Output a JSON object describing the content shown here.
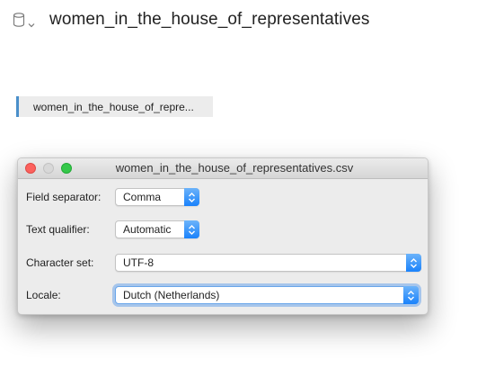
{
  "header": {
    "title": "women_in_the_house_of_representatives",
    "database_icon": "database-icon",
    "chevron_icon": "chevron-down-icon"
  },
  "source_tab": {
    "label": "women_in_the_house_of_repre..."
  },
  "dialog": {
    "title": "women_in_the_house_of_representatives.csv",
    "fields": [
      {
        "label": "Field separator:",
        "value": "Comma"
      },
      {
        "label": "Text qualifier:",
        "value": "Automatic"
      },
      {
        "label": "Character set:",
        "value": "UTF-8"
      },
      {
        "label": "Locale:",
        "value": "Dutch (Netherlands)"
      }
    ]
  },
  "colors": {
    "accent": "#1a82fb",
    "tab_marker": "#4a8fca",
    "close": "#fc615d",
    "minimize": "#d8d8d8",
    "zoom": "#35c84a"
  }
}
